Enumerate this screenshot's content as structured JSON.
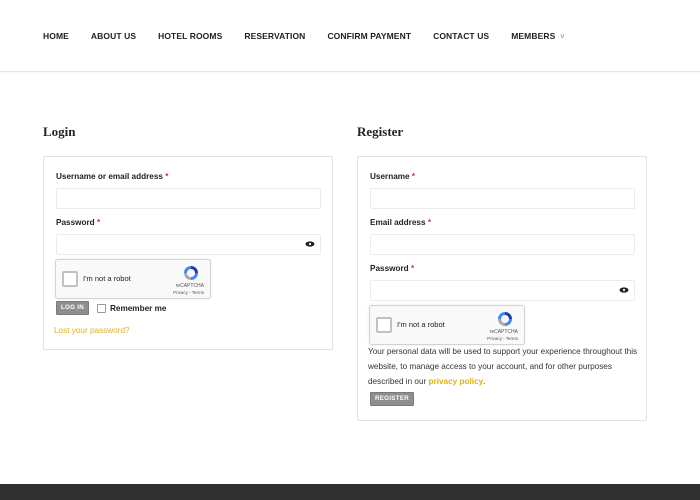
{
  "nav": {
    "items": [
      {
        "label": "HOME"
      },
      {
        "label": "ABOUT US"
      },
      {
        "label": "HOTEL ROOMS"
      },
      {
        "label": "RESERVATION"
      },
      {
        "label": "CONFIRM PAYMENT"
      },
      {
        "label": "CONTACT US"
      },
      {
        "label": "MEMBERS"
      }
    ],
    "members_chevron": "˅"
  },
  "login": {
    "title": "Login",
    "username_label": "Username or email address",
    "password_label": "Password",
    "required_mark": "*",
    "button_label": "LOG IN",
    "remember_label": "Remember me",
    "lost_password_label": "Lost your password?"
  },
  "register": {
    "title": "Register",
    "username_label": "Username",
    "email_label": "Email address",
    "password_label": "Password",
    "required_mark": "*",
    "privacy_text_before": "Your personal data will be used to support your experience throughout this website, to manage access to your account, and for other purposes described in our ",
    "privacy_link": "privacy policy",
    "privacy_text_after": ".",
    "button_label": "REGISTER"
  },
  "recaptcha": {
    "label": "I'm not a robot",
    "brand": "reCAPTCHA",
    "links": "Privacy - Terms"
  },
  "colors": {
    "accent": "#e0b020",
    "required": "#c0392b",
    "button": "#8e8e8e",
    "footer": "#2f2f2f"
  },
  "icons": {
    "password_toggle": "eye-icon",
    "recaptcha_logo": "recaptcha-logo-icon"
  }
}
